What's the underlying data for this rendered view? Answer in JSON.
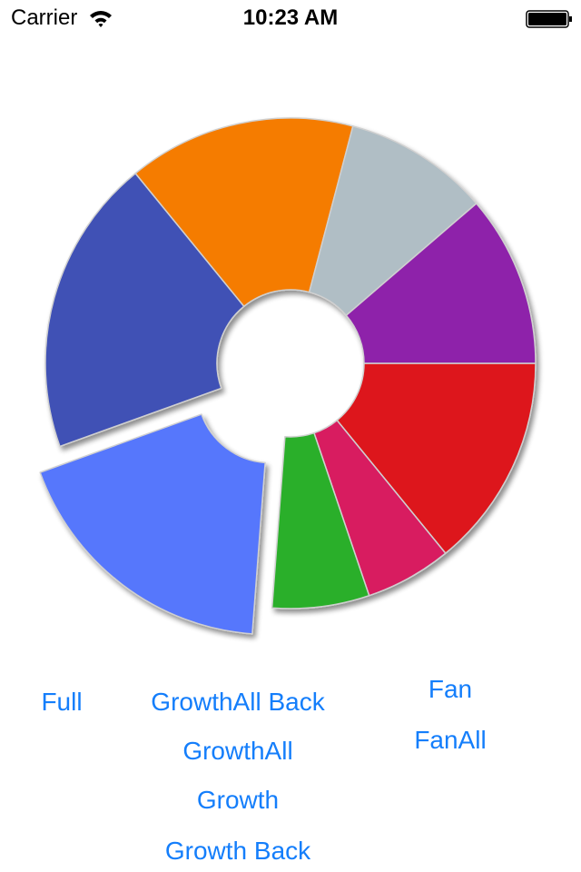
{
  "status_bar": {
    "carrier": "Carrier",
    "time": "10:23 AM",
    "wifi_icon": "wifi-icon",
    "battery_icon": "battery-full-icon",
    "battery_level": 1.0
  },
  "chart_data": {
    "type": "pie",
    "variant": "donut",
    "title": "",
    "start_angle_deg": 0,
    "direction": "clockwise",
    "inner_radius_ratio": 0.3,
    "slices": [
      {
        "name": "red",
        "value": 14.1,
        "color": "#DD191D",
        "exploded": false
      },
      {
        "name": "pink",
        "value": 5.7,
        "color": "#D81B60",
        "exploded": false
      },
      {
        "name": "green",
        "value": 6.4,
        "color": "#2BAF2B",
        "exploded": false
      },
      {
        "name": "light-blue",
        "value": 18.3,
        "color": "#5677FC",
        "exploded": true
      },
      {
        "name": "indigo",
        "value": 19.6,
        "color": "#3F51B5",
        "exploded": false
      },
      {
        "name": "orange",
        "value": 15.0,
        "color": "#F57C00",
        "exploded": false
      },
      {
        "name": "blue-grey",
        "value": 9.6,
        "color": "#B0BEC5",
        "exploded": false
      },
      {
        "name": "purple",
        "value": 11.3,
        "color": "#8E24AA",
        "exploded": false
      }
    ],
    "legend": "none",
    "labels_shown": false
  },
  "buttons": {
    "full": "Full",
    "growth_all_back": "GrowthAll Back",
    "growth_all": "GrowthAll",
    "growth": "Growth",
    "growth_back": "Growth Back",
    "fan": "Fan",
    "fan_all": "FanAll"
  },
  "colors": {
    "accent": "#147EFB",
    "slice_stroke": "#D0D0D0"
  }
}
